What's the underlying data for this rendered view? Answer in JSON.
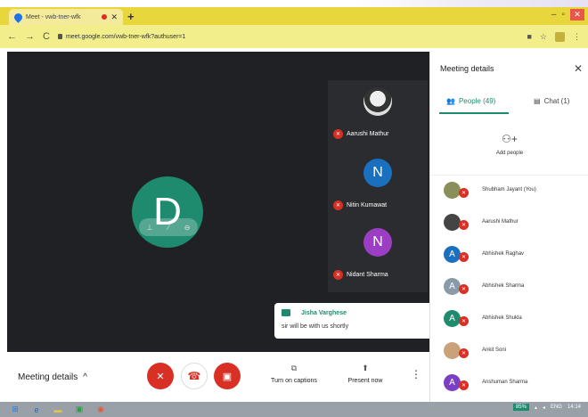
{
  "browser": {
    "tab_title": "Meet - vwb-tner-wfk",
    "new_tab": "+",
    "url": "meet.google.com/vwb-tner-wfk?authuser=1",
    "window": {
      "minimize": "–",
      "maximize": "▫",
      "close": "✕"
    }
  },
  "stage": {
    "presenter_letter": "D",
    "tiles": [
      {
        "name": "Aarushi Mathur",
        "letter": "",
        "color": "#333333",
        "photo": true
      },
      {
        "name": "Nitin Kumawat",
        "letter": "N",
        "color": "#1a6fbf",
        "photo": false
      },
      {
        "name": "Nidant Sharma",
        "letter": "N",
        "color": "#9c3ec4",
        "photo": false
      }
    ],
    "chat_toast": {
      "sender": "Jisha Varghese",
      "message": "sir will be with us shortly"
    }
  },
  "panel": {
    "title": "Meeting details",
    "tabs": {
      "people": "People (49)",
      "chat": "Chat (1)"
    },
    "add_people": "Add people",
    "participants": [
      {
        "name": "Shubham Jayant (You)",
        "letter": "",
        "color": "#8a8f5a"
      },
      {
        "name": "Aarushi Mathur",
        "letter": "",
        "color": "#444444"
      },
      {
        "name": "Abhishek Raghav",
        "letter": "A",
        "color": "#1a6fbf"
      },
      {
        "name": "Abhishek Sharma",
        "letter": "A",
        "color": "#8a9aa8"
      },
      {
        "name": "Abhishek Shukla",
        "letter": "A",
        "color": "#1e8a6e"
      },
      {
        "name": "Ankit Soni",
        "letter": "",
        "color": "#c9a27a"
      },
      {
        "name": "Anshuman Sharma",
        "letter": "A",
        "color": "#7b3fc4"
      }
    ]
  },
  "bottom": {
    "meeting_details": "Meeting details",
    "captions": "Turn on captions",
    "present": "Present now"
  },
  "taskbar": {
    "battery": "85%",
    "lang": "ENG",
    "time": "14:14"
  },
  "colors": {
    "accent": "#1e8a6e",
    "danger": "#d93025",
    "stage": "#202124"
  }
}
